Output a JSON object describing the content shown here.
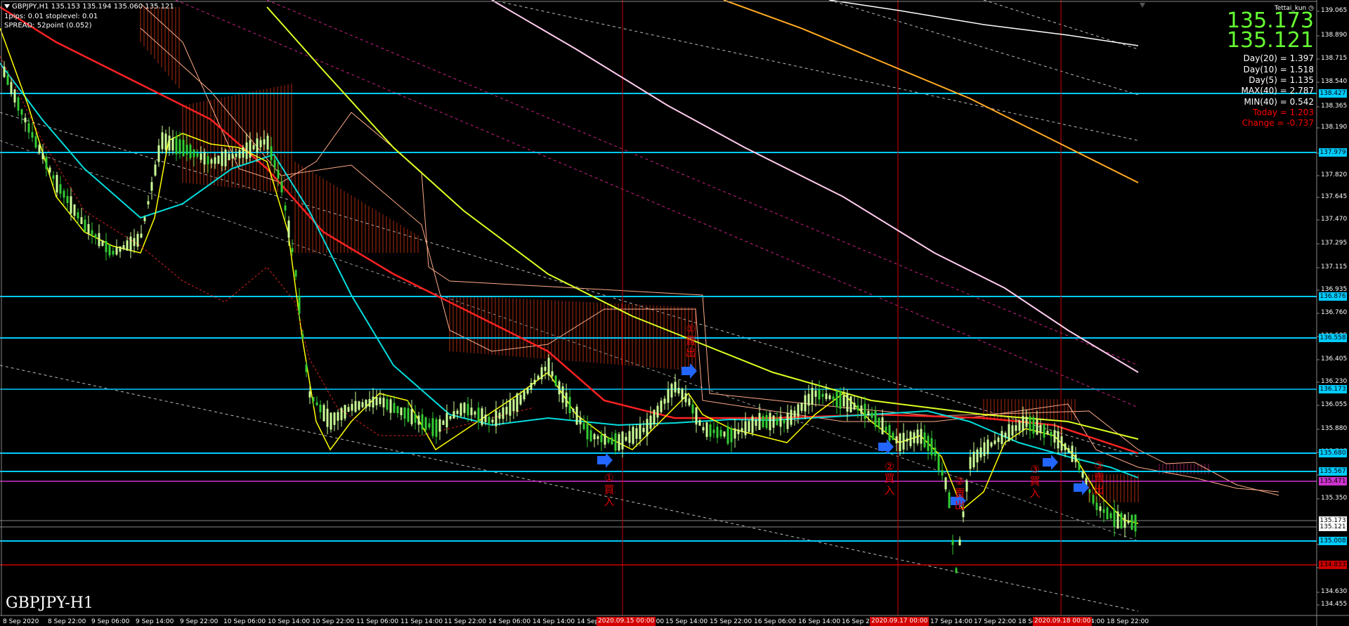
{
  "header": {
    "line1": "GBPJPY,H1  135.153 135.194 135.060 135.121",
    "line2": "1pips: 0.01  stoplevel: 0.01",
    "line3": "SPREAD: 52point (0.052)"
  },
  "owner": "Tettai_kun",
  "price": {
    "bid": "135.173",
    "ask": "135.121"
  },
  "stats": [
    {
      "text": "Day(20) = 1.397",
      "color": "#ffffff"
    },
    {
      "text": "Day(10) = 1.518",
      "color": "#ffffff"
    },
    {
      "text": "Day(5) = 1.135",
      "color": "#ffffff"
    },
    {
      "text": "MAX(40) = 2.787",
      "color": "#ffffff"
    },
    {
      "text": "MIN(40) = 0.542",
      "color": "#ffffff"
    },
    {
      "text": "Today = 1.203",
      "color": "#ff0000"
    },
    {
      "text": "Change = -0.737",
      "color": "#ff0000"
    }
  ],
  "symbol_label": "GBPJPY-H1",
  "colors": {
    "bull": "#ccff99",
    "bear": "#33cc33",
    "hline": "#00ccff",
    "vline": "#cc0000"
  },
  "axis": {
    "price_ticks": [
      "139.065",
      "138.890",
      "138.715",
      "138.540",
      "138.365",
      "138.190",
      "137.995",
      "137.820",
      "137.645",
      "137.470",
      "137.295",
      "137.115",
      "136.935",
      "136.760",
      "136.585",
      "136.405",
      "136.230",
      "136.055",
      "135.880",
      "135.705",
      "135.530",
      "135.350",
      "134.995",
      "134.820",
      "134.630",
      "134.455"
    ],
    "price_tags": [
      {
        "text": "138.427",
        "bg": "#00ccff"
      },
      {
        "text": "137.979",
        "bg": "#00ccff"
      },
      {
        "text": "136.876",
        "bg": "#00ccff"
      },
      {
        "text": "136.558",
        "bg": "#00ccff"
      },
      {
        "text": "136.173",
        "bg": "#00ccff"
      },
      {
        "text": "135.680",
        "bg": "#00ccff"
      },
      {
        "text": "135.567",
        "bg": "#00ccff"
      },
      {
        "text": "135.471",
        "bg": "#cc33cc"
      },
      {
        "text": "135.173",
        "bg": "#ffffff"
      },
      {
        "text": "135.121",
        "bg": "#ffffff"
      },
      {
        "text": "135.008",
        "bg": "#00ccff"
      },
      {
        "text": "134.833",
        "bg": "#cc0000"
      }
    ],
    "time_ticks": [
      "8 Sep 2020",
      "8 Sep 22:00",
      "9 Sep 06:00",
      "9 Sep 14:00",
      "9 Sep 22:00",
      "10 Sep 06:00",
      "10 Sep 14:00",
      "10 Sep 22:00",
      "11 Sep 06:00",
      "11 Sep 14:00",
      "11 Sep 22:00",
      "14 Sep 06:00",
      "14 Sep 14:00",
      "14 Sep 22:00",
      "15 Sep 06:00",
      "15 Sep 14:00",
      "15 Sep 22:00",
      "16 Sep 06:00",
      "16 Sep 14:00",
      "16 Sep 22:00",
      "17 Sep 06:00",
      "17 Sep 14:00",
      "17 Sep 22:00",
      "18 Sep 06:00",
      "18 Sep 14:00",
      "18 Sep 22:00"
    ],
    "time_flags": [
      "2020.09.15 00:00",
      "2020.09.17 00:00",
      "2020.09.18 00:00"
    ]
  },
  "annotations": [
    {
      "text": "①買入"
    },
    {
      "text": "①賣出"
    },
    {
      "text": "②買入"
    },
    {
      "text": "②賣出"
    },
    {
      "text": "③買入"
    },
    {
      "text": "③賣出"
    }
  ],
  "scroll_icon": "chart-shift-icon"
}
